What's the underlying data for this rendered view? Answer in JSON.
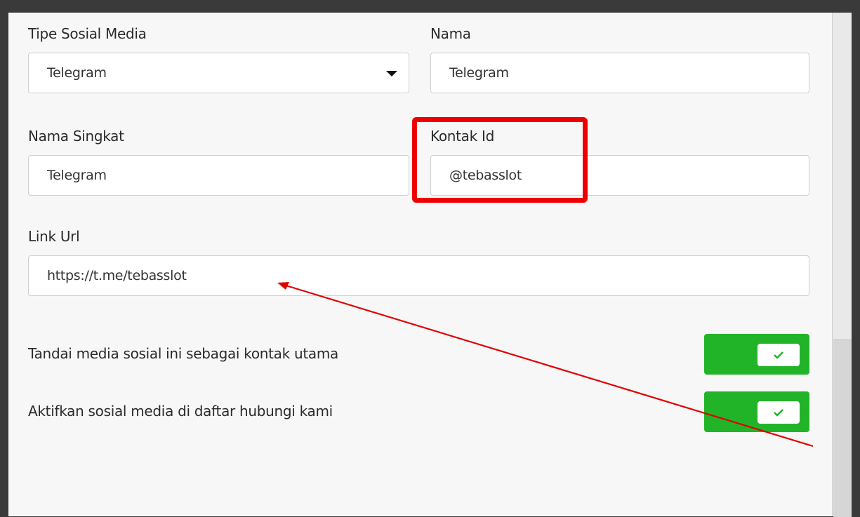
{
  "form": {
    "tipe_sosial_media": {
      "label": "Tipe Sosial Media",
      "value": "Telegram"
    },
    "nama": {
      "label": "Nama",
      "value": "Telegram"
    },
    "nama_singkat": {
      "label": "Nama Singkat",
      "value": "Telegram"
    },
    "kontak_id": {
      "label": "Kontak Id",
      "value": "@tebasslot"
    },
    "link_url": {
      "label": "Link Url",
      "value": "https://t.me/tebasslot"
    }
  },
  "toggles": [
    {
      "label": "Tandai media sosial ini sebagai kontak utama",
      "checked": true
    },
    {
      "label": "Aktifkan sosial media di daftar hubungi kami",
      "checked": true
    }
  ],
  "icons": {
    "caret": "chevron-down-icon",
    "check": "check-icon"
  },
  "colors": {
    "toggle_on": "#22b428",
    "annotation": "#ee0000"
  }
}
